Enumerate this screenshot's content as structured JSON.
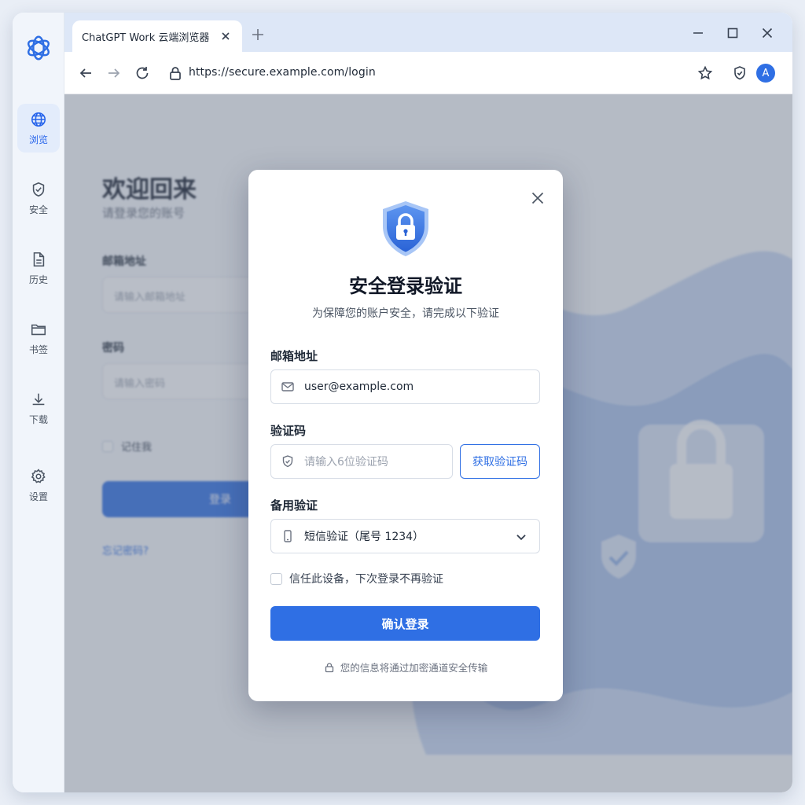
{
  "colors": {
    "accent": "#2f6fe4",
    "accent_light": "#e3ecfb",
    "rail_bg": "#f1f5fb"
  },
  "rail": {
    "logo_icon": "openai-logo-icon",
    "items": [
      {
        "label": "浏览",
        "icon": "globe-icon",
        "active": true
      },
      {
        "label": "安全",
        "icon": "shield-check-icon"
      },
      {
        "label": "历史",
        "icon": "document-icon"
      },
      {
        "label": "书签",
        "icon": "folder-icon"
      },
      {
        "label": "下载",
        "icon": "download-icon"
      },
      {
        "label": "设置",
        "icon": "gear-icon"
      }
    ]
  },
  "browser": {
    "tab_title": "ChatGPT Work 云端浏览器",
    "url": "https://secure.example.com/login",
    "avatar_letter": "A"
  },
  "page": {
    "title": "欢迎回来",
    "subtitle": "请登录您的账号",
    "email_label": "邮箱地址",
    "email_placeholder": "请输入邮箱地址",
    "password_label": "密码",
    "password_placeholder": "请输入密码",
    "remember_label": "记住我",
    "login_button": "登录",
    "forgot_link": "忘记密码?"
  },
  "modal": {
    "title": "安全登录验证",
    "subtitle": "为保障您的账户安全，请完成以下验证",
    "email_label": "邮箱地址",
    "email_value": "user@example.com",
    "code_label": "验证码",
    "code_placeholder": "请输入6位验证码",
    "get_code_button": "获取验证码",
    "backup_label": "备用验证",
    "backup_selected": "短信验证（尾号 1234）",
    "trust_label": "信任此设备，下次登录不再验证",
    "submit_button": "确认登录",
    "secure_note": "您的信息将通过加密通道安全传输"
  }
}
